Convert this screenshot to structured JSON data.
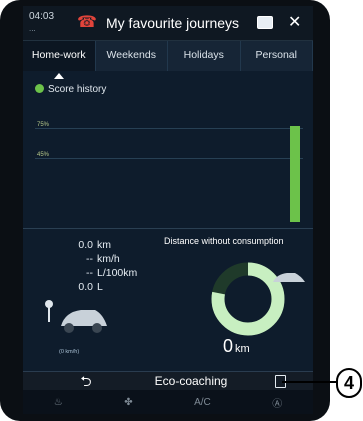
{
  "header": {
    "time": "04:03",
    "title": "My favourite journeys"
  },
  "tabs": [
    {
      "label": "Home-work",
      "active": true
    },
    {
      "label": "Weekends",
      "active": false
    },
    {
      "label": "Holidays",
      "active": false
    },
    {
      "label": "Personal",
      "active": false
    }
  ],
  "score": {
    "legend_label": "Score history",
    "line_labels": [
      "75%",
      "45%"
    ],
    "bar_color": "#6cc24a"
  },
  "stats": [
    {
      "value": "0.0",
      "unit": "km"
    },
    {
      "value": "--",
      "unit": "km/h"
    },
    {
      "value": "--",
      "unit": "L/100km"
    },
    {
      "value": "0.0",
      "unit": "L"
    }
  ],
  "distance": {
    "label": "Distance without consumption",
    "value": "0",
    "unit": "km",
    "gauge_fraction": 0.78
  },
  "small_label": "(0 km/h)",
  "bottom": {
    "eco_label": "Eco-coaching"
  },
  "climate": {
    "ac_label": "A/C"
  },
  "callout": "4",
  "colors": {
    "accent_green": "#6cc24a",
    "phone_red": "#e2443b"
  }
}
